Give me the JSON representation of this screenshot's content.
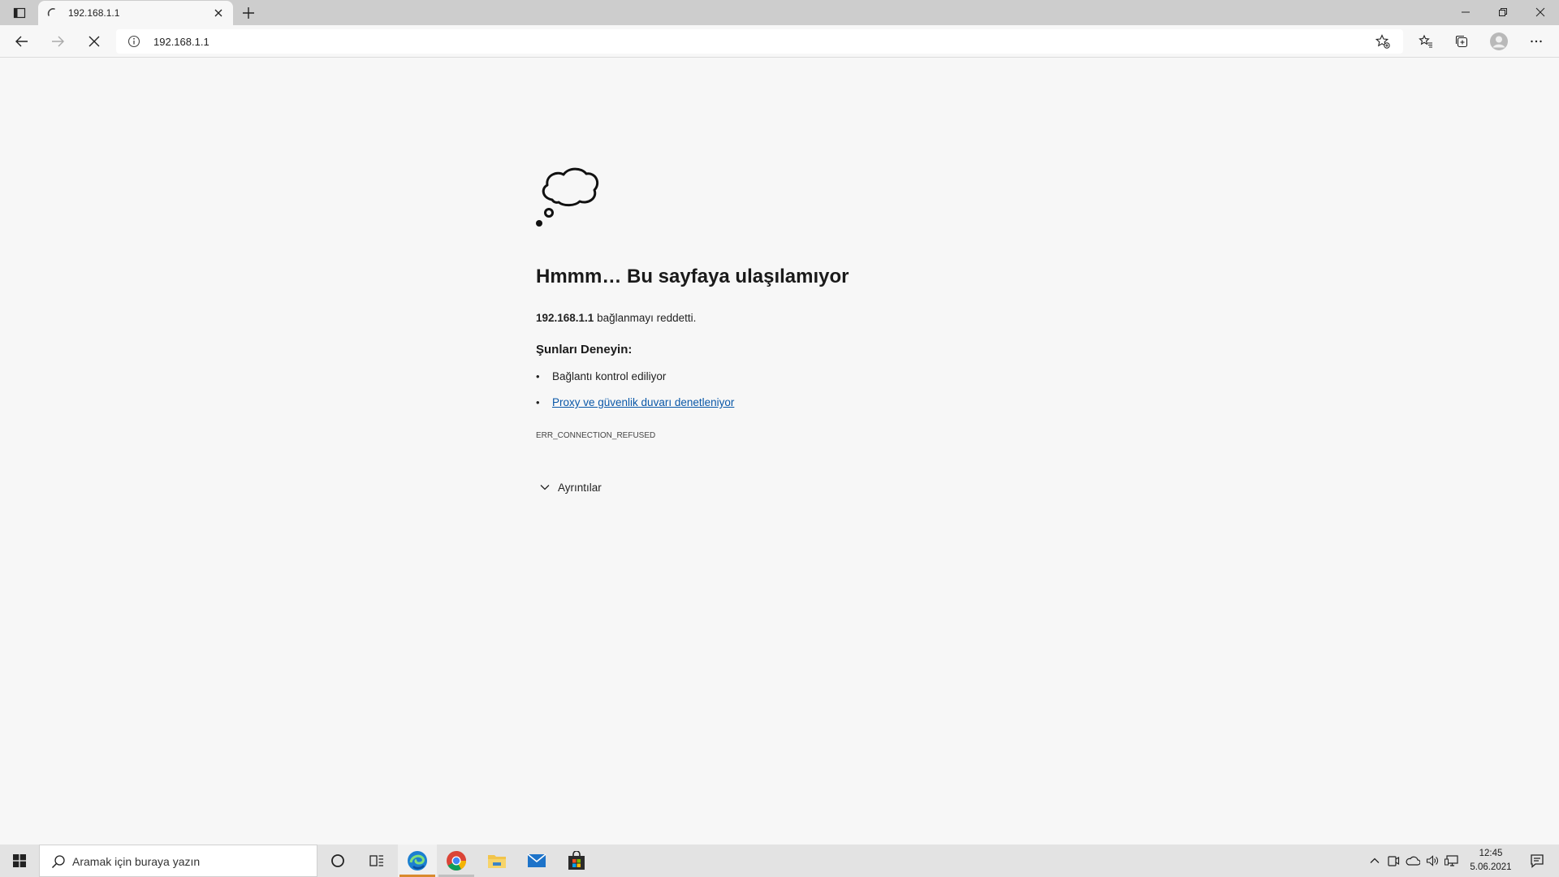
{
  "browser": {
    "tab": {
      "title": "192.168.1.1",
      "loading": true
    },
    "address_bar": {
      "url": "192.168.1.1"
    },
    "icons": {
      "tab_actions": "tab-actions-icon",
      "close_tab": "close-icon",
      "new_tab": "plus-icon",
      "back": "back-arrow-icon",
      "forward": "forward-arrow-icon",
      "stop": "stop-icon",
      "site_info": "info-icon",
      "add_favorite": "star-add-icon",
      "favorites": "favorites-icon",
      "collections": "collections-icon",
      "profile": "profile-icon",
      "menu": "more-icon"
    }
  },
  "error_page": {
    "title": "Hmmm… Bu sayfaya ulaşılamıyor",
    "host": "192.168.1.1",
    "description": " bağlanmayı reddetti.",
    "try_heading": "Şunları Deneyin:",
    "suggestions": [
      {
        "text": "Bağlantı kontrol ediliyor",
        "link": false
      },
      {
        "text": "Proxy ve güvenlik duvarı denetleniyor",
        "link": true
      }
    ],
    "bullet": "•",
    "error_code": "ERR_CONNECTION_REFUSED",
    "details_label": "Ayrıntılar"
  },
  "taskbar": {
    "search_placeholder": "Aramak için buraya yazın",
    "clock": {
      "time": "12:45",
      "date": "5.06.2021"
    },
    "apps": [
      "cortana-icon",
      "task-view-icon",
      "edge-icon",
      "chrome-icon",
      "file-explorer-icon",
      "mail-icon",
      "store-icon"
    ],
    "tray": [
      "chevron-up-icon",
      "meet-now-icon",
      "onedrive-icon",
      "volume-icon",
      "network-icon"
    ]
  },
  "colors": {
    "link": "#0a58a8",
    "edge_active_underline": "#d98a2e",
    "tabstrip": "#cdcdcd",
    "page_bg": "#f7f7f7"
  }
}
